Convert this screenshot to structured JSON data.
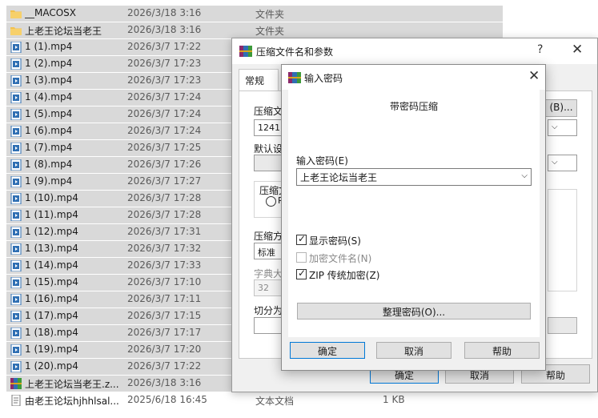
{
  "file_list": {
    "rows": [
      {
        "icon": "folder-icon",
        "name": "__MACOSX",
        "date": "2026/3/18 3:16",
        "type": "文件夹",
        "size": "",
        "selected": true
      },
      {
        "icon": "folder-icon",
        "name": "上老王论坛当老王",
        "date": "2026/3/18 3:16",
        "type": "文件夹",
        "size": "",
        "selected": true
      },
      {
        "icon": "mp4-icon",
        "name": "1 (1).mp4",
        "date": "2026/3/7 17:22",
        "type": "",
        "size": "",
        "selected": true
      },
      {
        "icon": "mp4-icon",
        "name": "1 (2).mp4",
        "date": "2026/3/7 17:23",
        "type": "",
        "size": "",
        "selected": true
      },
      {
        "icon": "mp4-icon",
        "name": "1 (3).mp4",
        "date": "2026/3/7 17:23",
        "type": "",
        "size": "",
        "selected": true
      },
      {
        "icon": "mp4-icon",
        "name": "1 (4).mp4",
        "date": "2026/3/7 17:24",
        "type": "",
        "size": "",
        "selected": true
      },
      {
        "icon": "mp4-icon",
        "name": "1 (5).mp4",
        "date": "2026/3/7 17:24",
        "type": "",
        "size": "",
        "selected": true
      },
      {
        "icon": "mp4-icon",
        "name": "1 (6).mp4",
        "date": "2026/3/7 17:24",
        "type": "",
        "size": "",
        "selected": true
      },
      {
        "icon": "mp4-icon",
        "name": "1 (7).mp4",
        "date": "2026/3/7 17:25",
        "type": "",
        "size": "",
        "selected": true
      },
      {
        "icon": "mp4-icon",
        "name": "1 (8).mp4",
        "date": "2026/3/7 17:26",
        "type": "",
        "size": "",
        "selected": true
      },
      {
        "icon": "mp4-icon",
        "name": "1 (9).mp4",
        "date": "2026/3/7 17:27",
        "type": "",
        "size": "",
        "selected": true
      },
      {
        "icon": "mp4-icon",
        "name": "1 (10).mp4",
        "date": "2026/3/7 17:28",
        "type": "",
        "size": "",
        "selected": true
      },
      {
        "icon": "mp4-icon",
        "name": "1 (11).mp4",
        "date": "2026/3/7 17:28",
        "type": "",
        "size": "",
        "selected": true
      },
      {
        "icon": "mp4-icon",
        "name": "1 (12).mp4",
        "date": "2026/3/7 17:31",
        "type": "",
        "size": "",
        "selected": true
      },
      {
        "icon": "mp4-icon",
        "name": "1 (13).mp4",
        "date": "2026/3/7 17:32",
        "type": "",
        "size": "",
        "selected": true
      },
      {
        "icon": "mp4-icon",
        "name": "1 (14).mp4",
        "date": "2026/3/7 17:33",
        "type": "",
        "size": "",
        "selected": true
      },
      {
        "icon": "mp4-icon",
        "name": "1 (15).mp4",
        "date": "2026/3/7 17:10",
        "type": "",
        "size": "",
        "selected": true
      },
      {
        "icon": "mp4-icon",
        "name": "1 (16).mp4",
        "date": "2026/3/7 17:11",
        "type": "",
        "size": "",
        "selected": true
      },
      {
        "icon": "mp4-icon",
        "name": "1 (17).mp4",
        "date": "2026/3/7 17:15",
        "type": "",
        "size": "",
        "selected": true
      },
      {
        "icon": "mp4-icon",
        "name": "1 (18).mp4",
        "date": "2026/3/7 17:17",
        "type": "",
        "size": "",
        "selected": true
      },
      {
        "icon": "mp4-icon",
        "name": "1 (19).mp4",
        "date": "2026/3/7 17:20",
        "type": "",
        "size": "",
        "selected": true
      },
      {
        "icon": "mp4-icon",
        "name": "1 (20).mp4",
        "date": "2026/3/7 17:22",
        "type": "",
        "size": "",
        "selected": true
      },
      {
        "icon": "rar-icon",
        "name": "上老王论坛当老王.z...",
        "date": "2026/3/18 3:16",
        "type": "",
        "size": "",
        "selected": true
      },
      {
        "icon": "text-file-icon",
        "name": "由老王论坛hjhhlsal...",
        "date": "2025/6/18 16:45",
        "type": "文本文档",
        "size": "1 KB",
        "selected": false
      }
    ]
  },
  "main_dialog": {
    "title": "压缩文件名和参数",
    "help_label": "?",
    "close_label": "✕",
    "tab_general": "常规",
    "archive_name_label": "压缩文",
    "archive_name_value": "1241.z",
    "browse_button": "(B)...",
    "default_profile_label": "默认设",
    "archive_format_label": "压缩文",
    "format_option_label": "R",
    "compression_method_label": "压缩方",
    "compression_method_value": "标准",
    "dictionary_size_label": "字典大",
    "dictionary_size_value": "32",
    "split_volumes_label": "切分为",
    "ok_button": "确定",
    "cancel_button": "取消",
    "help_button": "帮助"
  },
  "password_dialog": {
    "title": "输入密码",
    "close_label": "✕",
    "heading": "带密码压缩",
    "password_label": "输入密码(E)",
    "password_value": "上老王论坛当老王",
    "show_password_label": "显示密码(S)",
    "encrypt_filenames_label": "加密文件名(N)",
    "zip_legacy_label": "ZIP 传统加密(Z)",
    "show_password_checked": true,
    "encrypt_filenames_checked": false,
    "zip_legacy_checked": true,
    "manage_button": "整理密码(O)...",
    "ok_button": "确定",
    "cancel_button": "取消",
    "help_button": "帮助"
  },
  "colors": {
    "selection": "#d9d9d9",
    "dialog_bg": "#f0f0f0",
    "focus_border": "#0078d7",
    "folder": "#f2c14e",
    "video_icon": "#2f6fb3"
  }
}
